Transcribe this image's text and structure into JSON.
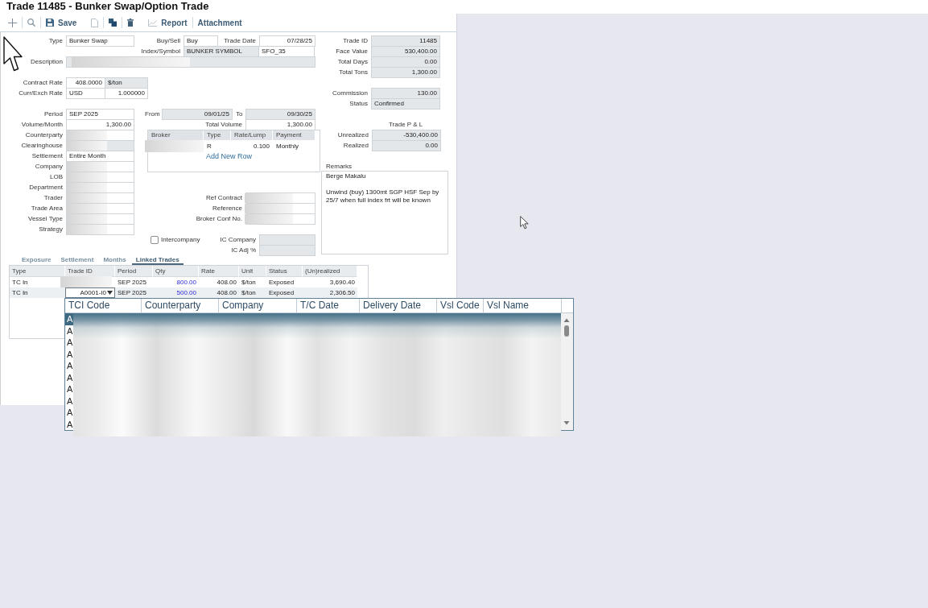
{
  "title": "Trade 11485 - Bunker Swap/Option Trade",
  "toolbar": [
    "Save",
    "Report",
    "Attachment"
  ],
  "trade": {
    "type": {
      "label": "Type",
      "value": "Bunker Swap",
      "kind": "text",
      "readonly": false
    },
    "buy_sell": {
      "label": "Buy/Sell",
      "value": "Buy",
      "kind": "text",
      "readonly": false
    },
    "trade_date": {
      "label": "Trade Date",
      "value": "07/28/25",
      "kind": "date",
      "readonly": false
    },
    "index_symbol": {
      "label": "Index/Symbol",
      "inputs": [
        {
          "value": "BUNKER SYMBOL",
          "kind": "text",
          "readonly": true
        },
        {
          "value": "SFO_35",
          "kind": "text",
          "readonly": false
        }
      ]
    },
    "description": {
      "label": "Description",
      "readonly": true,
      "redacted": true
    },
    "contract_rate": {
      "label": "Contract Rate",
      "inputs": [
        {
          "value": "408.0000",
          "kind": "number",
          "readonly": false
        },
        {
          "value": "$/ton",
          "kind": "text",
          "readonly": true
        }
      ]
    },
    "curr_exch_rate": {
      "label": "Curr/Exch Rate",
      "inputs": [
        {
          "value": "USD",
          "kind": "text",
          "readonly": false
        },
        {
          "value": "1.000000",
          "kind": "number",
          "readonly": false
        }
      ]
    }
  },
  "summary": [
    {
      "label": "Trade ID",
      "value": "11485",
      "kind": "number",
      "readonly": true
    },
    {
      "label": "Face Value",
      "value": "530,400.00",
      "kind": "number",
      "readonly": true
    },
    {
      "label": "Total Days",
      "value": "0.00",
      "kind": "number",
      "readonly": true
    },
    {
      "label": "Total Tons",
      "value": "1,300.00",
      "kind": "number",
      "readonly": true
    }
  ],
  "fees": [
    {
      "label": "Commission",
      "value": "130.00",
      "kind": "number",
      "readonly": true
    },
    {
      "label": "Status",
      "value": "Confirmed",
      "kind": "text",
      "readonly": true
    }
  ],
  "details": [
    {
      "label": "Period",
      "value": "SEP 2025",
      "kind": "text",
      "readonly": false
    },
    {
      "label": "Volume/Month",
      "value": "1,300.00",
      "kind": "number",
      "readonly": false
    },
    {
      "label": "Counterparty",
      "readonly": false,
      "redacted": true
    },
    {
      "label": "Clearinghouse",
      "readonly": true,
      "redacted": true
    },
    {
      "label": "Settlement",
      "value": "Entire Month",
      "kind": "text",
      "readonly": false
    },
    {
      "label": "Company",
      "readonly": false,
      "redacted": true
    },
    {
      "label": "LOB",
      "readonly": false,
      "redacted": true
    },
    {
      "label": "Department",
      "readonly": false,
      "redacted": true
    },
    {
      "label": "Trader",
      "readonly": false,
      "redacted": true
    },
    {
      "label": "Trade Area",
      "readonly": false,
      "redacted": true
    },
    {
      "label": "Vessel Type",
      "readonly": false,
      "redacted": true
    },
    {
      "label": "Strategy",
      "readonly": false,
      "redacted": true
    }
  ],
  "dates": {
    "from": {
      "label": "From",
      "value": "09/01/25",
      "kind": "date",
      "readonly": true
    },
    "to": {
      "label": "To",
      "value": "09/30/25",
      "kind": "date",
      "readonly": true
    },
    "total_volume": {
      "label": "Total Volume",
      "value": "1,300.00",
      "kind": "number",
      "readonly": false
    }
  },
  "brokers": {
    "columns": [
      "Broker",
      "Type",
      "Rate/Lump",
      "Payment"
    ],
    "rows": [
      {
        "broker_redacted": true,
        "type": "R",
        "rate_lump": "0.100",
        "payment": "Monthly"
      }
    ],
    "add_row": "Add New Row"
  },
  "references": [
    {
      "label": "Ref Contract",
      "readonly": false,
      "redacted": true
    },
    {
      "label": "Reference",
      "readonly": false,
      "redacted": true
    },
    {
      "label": "Broker Conf No.",
      "readonly": false,
      "redacted": true
    }
  ],
  "intercompany": {
    "label": "Intercompany",
    "checked": false
  },
  "ic_fields": [
    {
      "label": "IC Company",
      "readonly": true
    },
    {
      "label": "IC Adj %",
      "readonly": true
    }
  ],
  "pnl": {
    "title": "Trade P & L",
    "fields": [
      {
        "label": "Unrealized",
        "value": "-530,400.00",
        "kind": "number",
        "readonly": true
      },
      {
        "label": "Realized",
        "value": "0.00",
        "kind": "number",
        "readonly": true
      }
    ]
  },
  "remarks": {
    "label": "Remarks",
    "value": "Berge Makalu\n\nUnwind (buy) 1300mt SGP HSF Sep by 25/7 when full index frt will be known"
  },
  "tabs": [
    {
      "label": "Exposure",
      "selected": false
    },
    {
      "label": "Settlement",
      "selected": false
    },
    {
      "label": "Months",
      "selected": false
    },
    {
      "label": "Linked Trades",
      "selected": true
    }
  ],
  "linked_trades": {
    "columns": [
      "Type",
      "Trade ID",
      "Period",
      "Qty",
      "Rate",
      "Unit",
      "Status",
      "(Un)realized"
    ],
    "rows": [
      {
        "type": "TC In",
        "trade_id": {
          "redacted": true,
          "editing": false
        },
        "period": "SEP 2025",
        "qty": "800.00",
        "rate": "408.00",
        "unit": "$/ton",
        "status": "Exposed",
        "unrealized": "3,690.40",
        "selected": false
      },
      {
        "type": "TC In",
        "trade_id": {
          "value": "A0001-I0",
          "editing": true
        },
        "period": "SEP 2025",
        "qty": "500.00",
        "rate": "408.00",
        "unit": "$/ton",
        "status": "Exposed",
        "unrealized": "2,306.50",
        "selected": true
      }
    ]
  },
  "tci_dropdown": {
    "columns": [
      "TCI Code",
      "Counterparty",
      "Company",
      "T/C Date",
      "Delivery Date",
      "Vsl Code",
      "Vsl Name"
    ],
    "rows": [
      {
        "tci_code": "A",
        "selected": true
      },
      {
        "tci_code": "A",
        "selected": false
      },
      {
        "tci_code": "A",
        "selected": false
      },
      {
        "tci_code": "A",
        "selected": false
      },
      {
        "tci_code": "A",
        "selected": false
      },
      {
        "tci_code": "A",
        "selected": false
      },
      {
        "tci_code": "A",
        "selected": false
      },
      {
        "tci_code": "A",
        "selected": false
      },
      {
        "tci_code": "A",
        "selected": false
      },
      {
        "tci_code": "A",
        "selected": false
      }
    ],
    "redacted": true
  }
}
